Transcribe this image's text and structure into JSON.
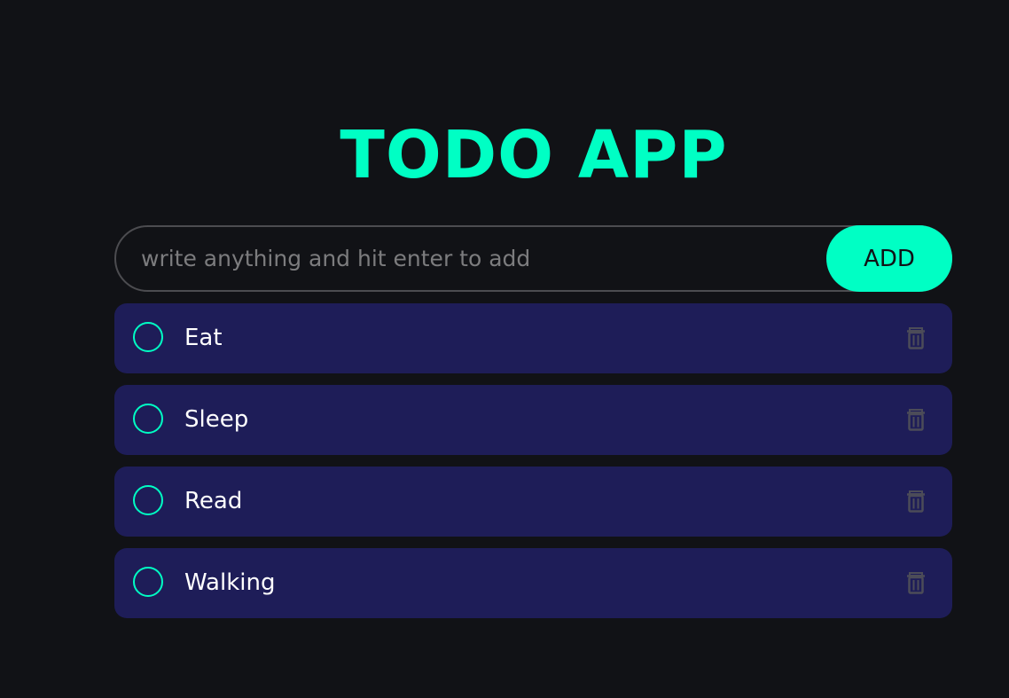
{
  "app": {
    "title": "TODO APP"
  },
  "input": {
    "value": "",
    "placeholder": "write anything and hit enter to add",
    "add_label": "ADD"
  },
  "todos": [
    {
      "text": "Eat",
      "done": false,
      "delete_icon": "trash-icon"
    },
    {
      "text": "Sleep",
      "done": false,
      "delete_icon": "trash-icon"
    },
    {
      "text": "Read",
      "done": false,
      "delete_icon": "trash-icon"
    },
    {
      "text": "Walking",
      "done": false,
      "delete_icon": "trash-icon"
    }
  ],
  "colors": {
    "background": "#111216",
    "accent": "#00ffc4",
    "item_background": "#1e1d58",
    "input_border": "#4c4c50",
    "placeholder": "#7c7c7e",
    "trash_icon": "#4c4c58",
    "text": "#ffffff"
  }
}
